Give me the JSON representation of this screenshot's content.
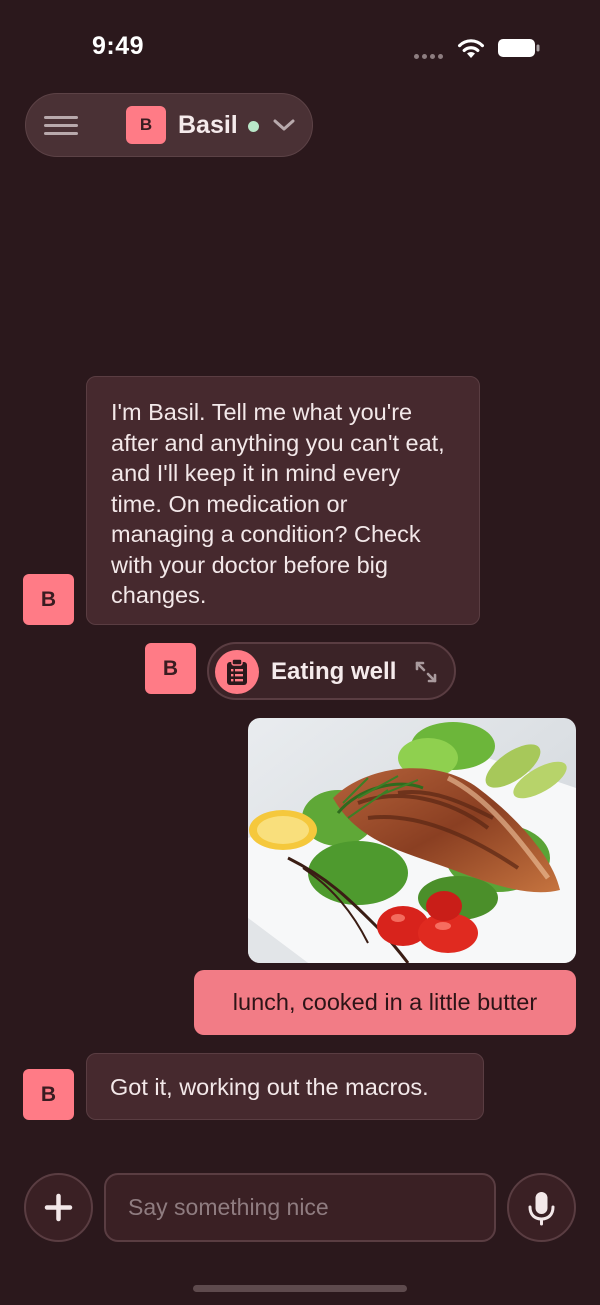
{
  "status_bar": {
    "time": "9:49",
    "icons": [
      "signal-dots-icon",
      "wifi-icon",
      "battery-icon"
    ]
  },
  "header": {
    "menu_icon": "hamburger-menu-icon",
    "avatar_letter": "B",
    "bot_name": "Basil",
    "status": "online",
    "chevron_icon": "chevron-down-icon"
  },
  "messages": [
    {
      "sender": "bot",
      "avatar_letter": "B",
      "text": "I'm Basil. Tell me what you're after and anything you can't eat, and I'll keep it in mind every time. On medication or managing a condition? Check with your doctor before big changes."
    },
    {
      "sender": "bot",
      "avatar_letter": "B",
      "tool": {
        "icon": "clipboard-list-icon",
        "label": "Eating well",
        "action_icon": "expand-icon"
      }
    },
    {
      "sender": "user",
      "image": "grilled-salmon-salad-photo",
      "text": "lunch, cooked in a little butter"
    },
    {
      "sender": "bot",
      "avatar_letter": "B",
      "text": "Got it, working out the macros."
    }
  ],
  "composer": {
    "add_icon": "plus-icon",
    "placeholder": "Say something nice",
    "value": "",
    "mic_icon": "microphone-icon"
  },
  "colors": {
    "background": "#2b181c",
    "accent": "#ff7b86",
    "user_bubble": "#f27c86",
    "bot_bubble": "#46292e",
    "online": "#b9e7c8"
  }
}
